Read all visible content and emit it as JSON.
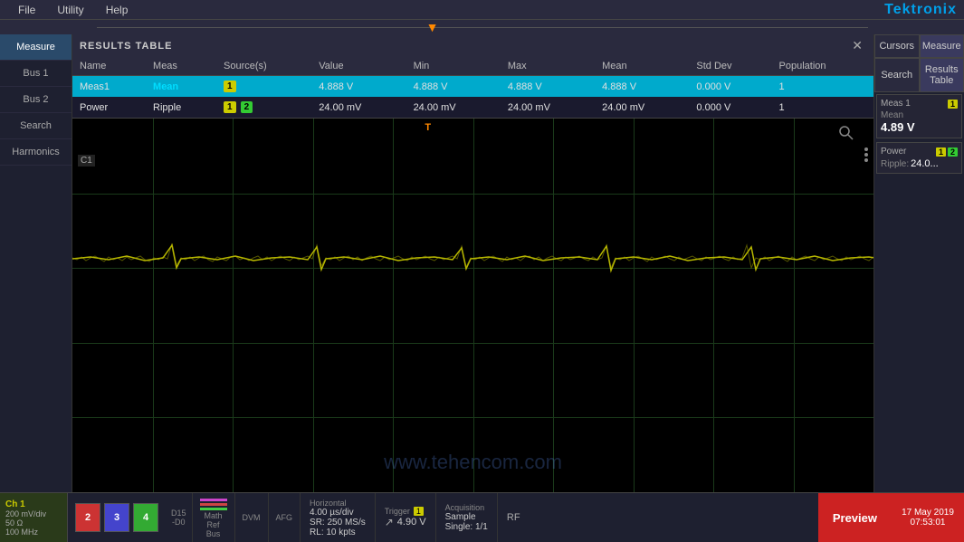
{
  "app": {
    "title": "Tektronix"
  },
  "menu": {
    "items": [
      "File",
      "Utility",
      "Help"
    ]
  },
  "sidebar": {
    "items": [
      {
        "label": "Measure",
        "active": true
      },
      {
        "label": "Bus 1",
        "active": false
      },
      {
        "label": "Bus 2",
        "active": false
      },
      {
        "label": "Search",
        "active": false
      },
      {
        "label": "Harmonics",
        "active": false
      }
    ]
  },
  "results_table": {
    "title": "RESULTS TABLE",
    "close_btn": "✕",
    "columns": [
      "Name",
      "Meas",
      "Source(s)",
      "Value",
      "Min",
      "Max",
      "Mean",
      "Std Dev",
      "Population"
    ],
    "rows": [
      {
        "name": "Meas1",
        "meas": "Mean",
        "source": "1",
        "value": "4.888 V",
        "min": "4.888 V",
        "max": "4.888 V",
        "mean": "4.888 V",
        "std_dev": "0.000 V",
        "population": "1",
        "highlight": true
      },
      {
        "name": "Power",
        "meas": "Ripple",
        "source": "1,2",
        "value": "24.00 mV",
        "min": "24.00 mV",
        "max": "24.00 mV",
        "mean": "24.00 mV",
        "std_dev": "0.000 V",
        "population": "1",
        "highlight": false
      }
    ]
  },
  "right_panel": {
    "buttons": [
      "Cursors",
      "Measure",
      "Search",
      "Results Table"
    ],
    "meas1": {
      "label": "Meas 1",
      "badge": "1",
      "type": "Mean",
      "value": "4.89 V"
    },
    "power": {
      "label": "Power",
      "badge1": "1",
      "badge2": "2",
      "type": "Ripple:",
      "value": "24.0..."
    }
  },
  "scope": {
    "c1_label": "C1",
    "trigger_label": "T"
  },
  "bottom_bar": {
    "ch1": {
      "title": "Ch 1",
      "div": "200 mV/div",
      "ohm": "50 Ω",
      "freq": "100 MHz"
    },
    "channels": [
      {
        "label": "2",
        "color": "ch-btn-2"
      },
      {
        "label": "3",
        "color": "ch-btn-3"
      },
      {
        "label": "4",
        "color": "ch-btn-4"
      }
    ],
    "d15": {
      "label": "D15\n-D0"
    },
    "math_ref_bus": {
      "label": "Math\nRef\nBus"
    },
    "dvm": {
      "label": "DVM"
    },
    "afg": {
      "label": "AFG"
    },
    "horizontal": {
      "title": "Horizontal",
      "div": "4.00 µs/div",
      "sr": "SR: 250 MS/s",
      "rl": "RL: 10 kpts"
    },
    "trigger": {
      "title": "Trigger",
      "badge": "1",
      "arrow": "↗",
      "value": "4.90 V"
    },
    "acquisition": {
      "title": "Acquisition",
      "type": "Sample",
      "single": "Single: 1/1"
    },
    "rf": "RF",
    "preview": "Preview",
    "date": "17 May 2019",
    "time": "07:53:01"
  }
}
